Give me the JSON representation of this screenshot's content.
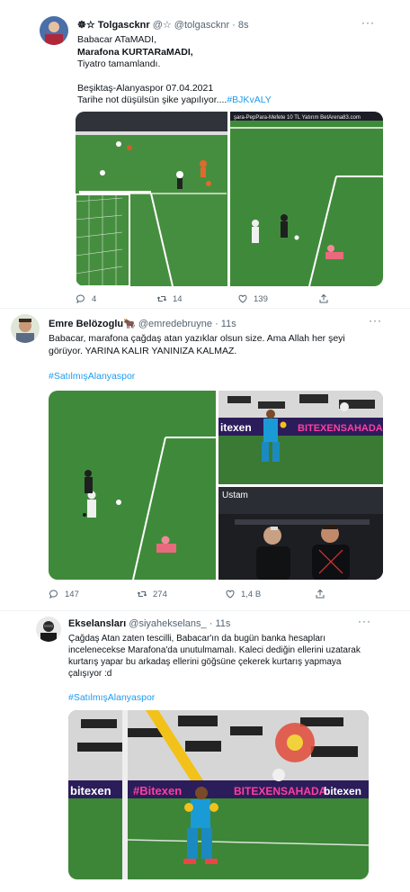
{
  "tweets": [
    {
      "display_name": "☸☆ Tolgascknr",
      "handle": "@☆ @tolgascknr",
      "time": "8s",
      "lines": [
        "Babacar ATaMADI,",
        "Marafona KURTARaMADI,",
        "Tiyatro tamamlandı.",
        "",
        "Beşiktaş-Alanyaspor 07.04.2021",
        "Tarihe not düşülsün şike yapılıyor....",
        "#BJKvALY"
      ],
      "overlay_text": "şara-PepPara-Mefete 10 TL Yatırım BetArena83.com",
      "replies": "4",
      "retweets": "14",
      "likes": "139"
    },
    {
      "display_name": "Emre Belözoglu🐂",
      "handle": "@emredebruyne",
      "time": "11s",
      "lines": [
        "Babacar, marafona çağdaş atan yazıklar olsun size. Ama Allah her şeyi",
        "görüyor. YARINA KALIR YANINIZA KALMAZ."
      ],
      "hashtag": "#SatılmışAlanyaspor",
      "inset_label": "Ustam",
      "board_text_1": "itexen",
      "board_text_2": "BITEXENSAHADA",
      "replies": "147",
      "retweets": "274",
      "likes": "1,4 B"
    },
    {
      "display_name": "Ekselansları",
      "handle": "@siyahekselans_",
      "time": "11s",
      "lines": [
        "Çağdaş Atan zaten tescilli, Babacar'ın da bugün banka hesapları",
        "incelenecekse Marafona'da unutulmamalı. Kaleci dediğin ellerini uzatarak",
        "kurtarış yapar bu arkadaş ellerini göğsüne çekerek kurtarış yapmaya",
        "çalışıyor :d"
      ],
      "hashtag": "#SatılmışAlanyaspor",
      "board_text_1": "bitexen",
      "board_text_2": "#Bitexen",
      "board_text_3": "BITEXENSAHADA",
      "board_text_4": "bitexen"
    }
  ],
  "colors": {
    "link": "#1d9bf0",
    "muted": "#536471",
    "pitch": "#3f8a3a",
    "pitch_dark": "#2f6e2c",
    "board": "#2b1c5a",
    "board_text": "#ff3fa0"
  }
}
